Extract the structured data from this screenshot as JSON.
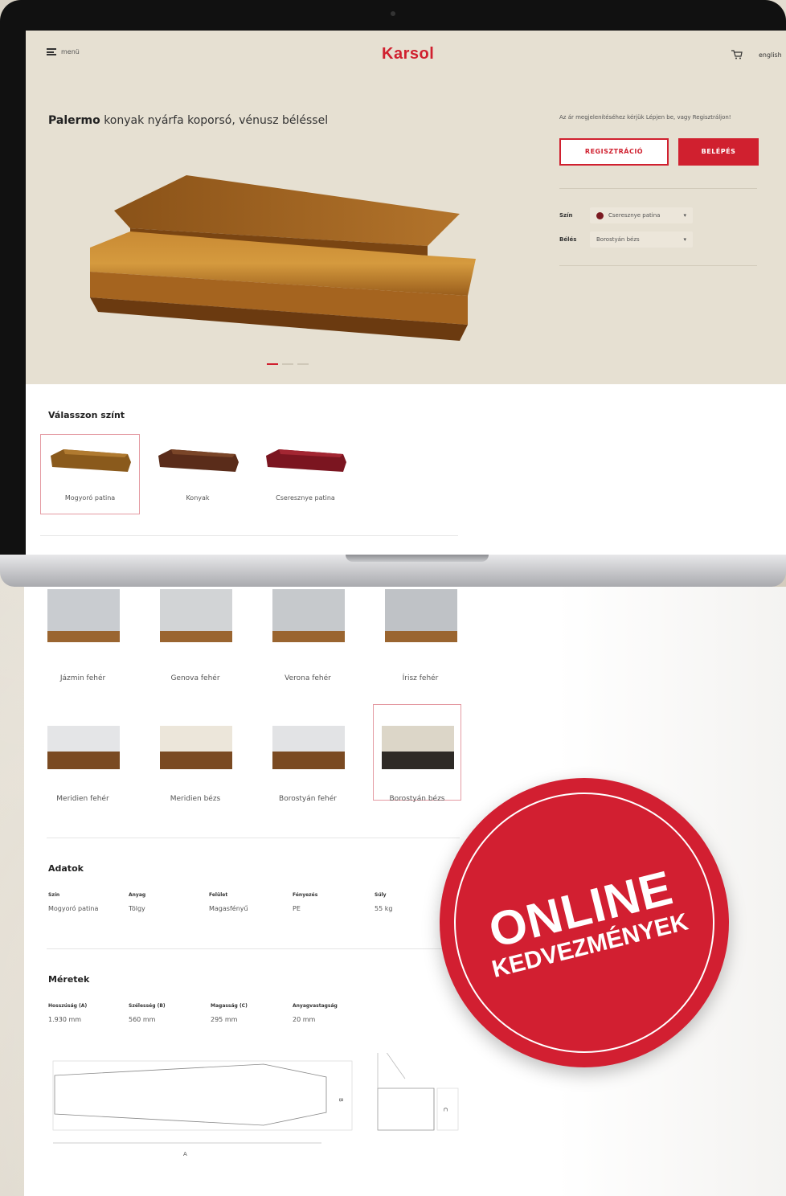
{
  "header": {
    "menu_label": "menü",
    "logo": "Karsol",
    "language": "english"
  },
  "product": {
    "name": "Palermo",
    "title_rest": " konyak nyárfa koporsó, vénusz béléssel"
  },
  "login": {
    "note": "Az ár megjelenítéséhez kérjük Lépjen be, vagy Regisztráljon!",
    "register_button": "REGISZTRÁCIÓ",
    "login_button": "BELÉPÉS"
  },
  "options": {
    "color_label": "Szín",
    "color_value": "Cseresznye patina",
    "lining_label": "Bélés",
    "lining_value": "Borostyán bézs"
  },
  "color_section": {
    "title": "Válasszon színt",
    "items": [
      {
        "label": "Mogyoró patina",
        "color": "#8a5a1c"
      },
      {
        "label": "Konyak",
        "color": "#5a2c1a"
      },
      {
        "label": "Cseresznye patina",
        "color": "#7b1520"
      }
    ]
  },
  "linings": [
    {
      "label": "Jázmin fehér"
    },
    {
      "label": "Genova fehér"
    },
    {
      "label": "Verona fehér"
    },
    {
      "label": "Írisz fehér"
    },
    {
      "label": "Meridien fehér"
    },
    {
      "label": "Meridien bézs"
    },
    {
      "label": "Borostyán fehér"
    },
    {
      "label": "Borostyán bézs"
    }
  ],
  "data_section": {
    "title": "Adatok",
    "specs": [
      {
        "key": "Szín",
        "value": "Mogyoró patina"
      },
      {
        "key": "Anyag",
        "value": "Tölgy"
      },
      {
        "key": "Felület",
        "value": "Magasfényű"
      },
      {
        "key": "Fényezés",
        "value": "PE"
      },
      {
        "key": "Súly",
        "value": "55 kg"
      }
    ]
  },
  "size_section": {
    "title": "Méretek",
    "specs": [
      {
        "key": "Hosszúság (A)",
        "value": "1.930 mm"
      },
      {
        "key": "Szélesség (B)",
        "value": "560 mm"
      },
      {
        "key": "Magasság (C)",
        "value": "295 mm"
      },
      {
        "key": "Anyagvastagság",
        "value": "20 mm"
      }
    ],
    "diagram_labels": {
      "a": "A",
      "b": "B",
      "c": "C"
    }
  },
  "badge": {
    "line1": "ONLINE",
    "line2": "KEDVEZMÉNYEK"
  },
  "colors": {
    "accent": "#d0202f",
    "hero_bg": "#e6e0d2"
  }
}
